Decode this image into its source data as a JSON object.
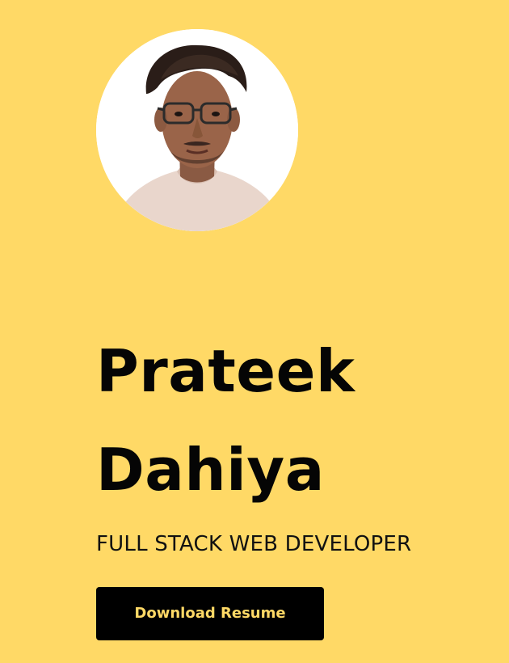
{
  "profile": {
    "avatar_alt": "Profile photo",
    "first_name": "Prateek",
    "last_name": "Dahiya",
    "role": "FULL STACK WEB DEVELOPER",
    "download_label": "Download Resume"
  },
  "colors": {
    "background": "#FFD966",
    "text": "#050505",
    "button_bg": "#000000",
    "button_text": "#FFD966"
  }
}
